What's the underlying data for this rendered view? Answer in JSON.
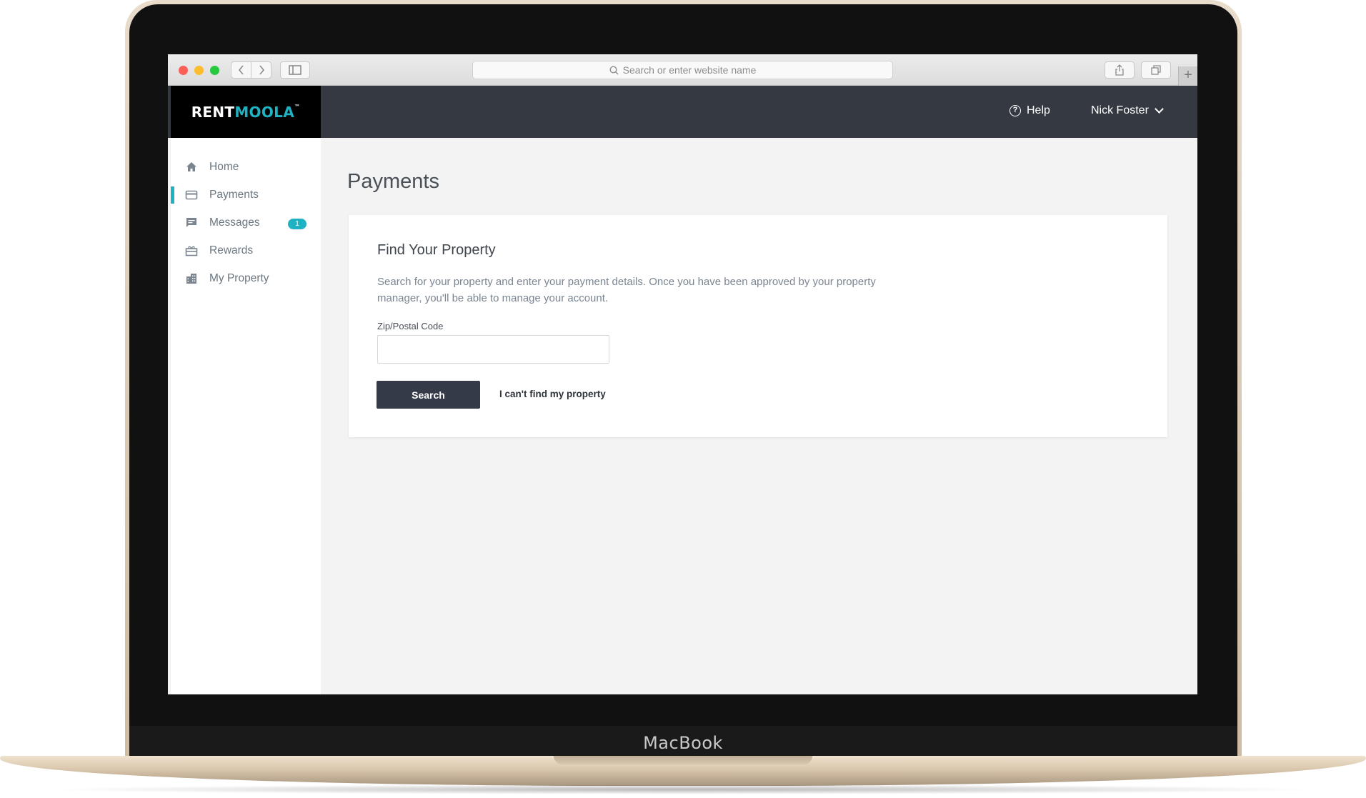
{
  "device": {
    "label": "MacBook"
  },
  "browser": {
    "url_placeholder": "Search or enter website name",
    "back_icon": "chevron-left-icon",
    "forward_icon": "chevron-right-icon",
    "sidebar_icon": "sidebar-icon",
    "share_icon": "share-icon",
    "tabs_icon": "tabs-icon",
    "new_tab_icon": "plus-icon"
  },
  "header": {
    "logo": {
      "part1": "RENT",
      "part2": "MOOLA",
      "tm": "™"
    },
    "help_label": "Help",
    "user_name": "Nick Foster"
  },
  "sidebar": {
    "items": [
      {
        "label": "Home",
        "icon": "home-icon",
        "active": false
      },
      {
        "label": "Payments",
        "icon": "credit-card-icon",
        "active": true
      },
      {
        "label": "Messages",
        "icon": "message-icon",
        "active": false,
        "badge": "1"
      },
      {
        "label": "Rewards",
        "icon": "gift-icon",
        "active": false
      },
      {
        "label": "My Property",
        "icon": "building-icon",
        "active": false
      }
    ]
  },
  "main": {
    "title": "Payments",
    "card": {
      "title": "Find Your Property",
      "description": "Search for your property and enter your payment details. Once you have been approved by your property manager, you'll be able to manage your account.",
      "zip_label": "Zip/Postal Code",
      "zip_value": "",
      "search_button": "Search",
      "cant_find_link": "I can't find my property"
    }
  },
  "colors": {
    "accent": "#1eb2c2",
    "header_bg": "#353a42",
    "logo_bg": "#000000",
    "button_bg": "#353a48",
    "page_bg": "#f3f3f3"
  }
}
